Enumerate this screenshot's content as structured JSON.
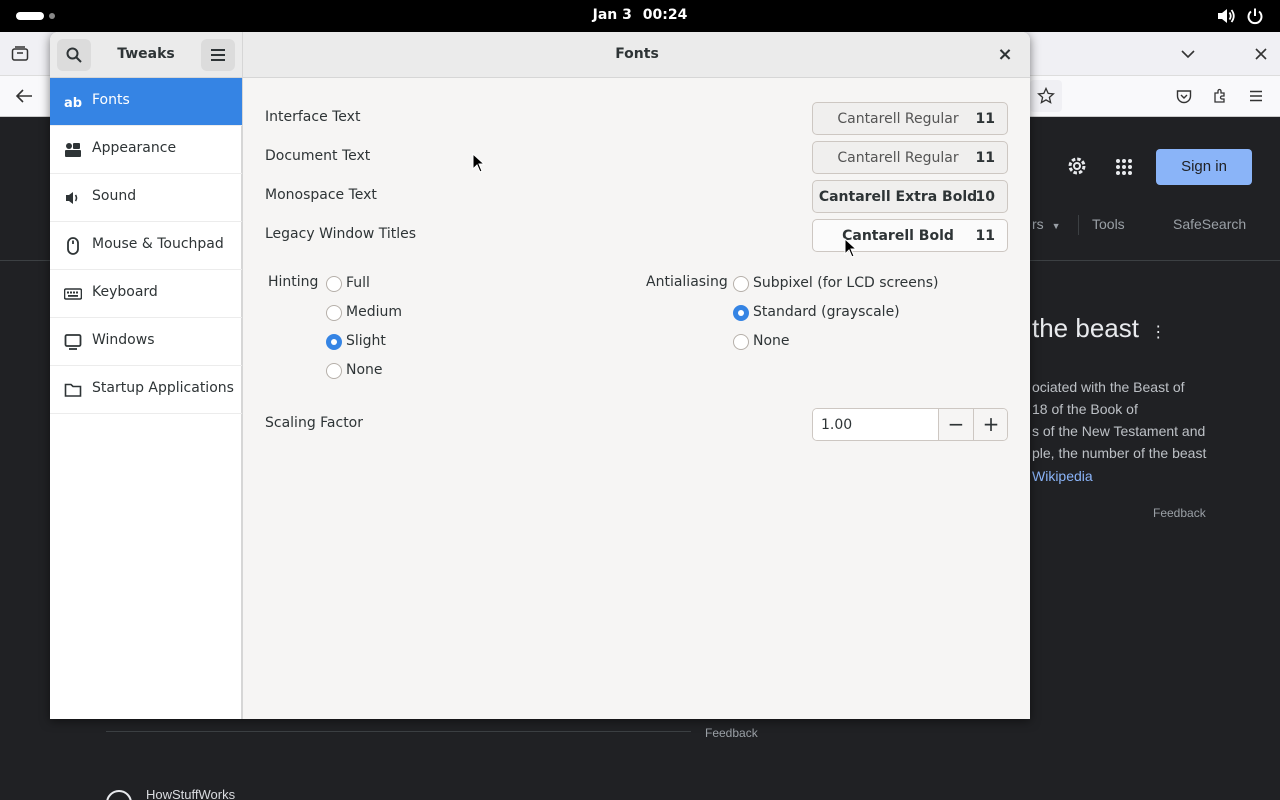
{
  "topbar": {
    "date": "Jan 3",
    "time": "00:24",
    "volume_icon": "volume-icon",
    "power_icon": "power-icon"
  },
  "browser": {
    "signin_label": "Sign in",
    "tabs_partial": [
      "rs",
      "Tools",
      "SafeSearch"
    ],
    "heading_partial": "the beast",
    "snippet_lines": [
      "ociated with the Beast of",
      "18 of the Book of",
      "s of the New Testament and",
      "ple, the number of the beast",
      "Wikipedia"
    ],
    "feedback_right": "Feedback",
    "feedback_bottom": "Feedback",
    "source_name": "HowStuffWorks"
  },
  "tweaks": {
    "title": "Tweaks",
    "page_title": "Fonts",
    "close_label": "×",
    "sidebar": [
      {
        "label": "Fonts",
        "icon": "text-icon",
        "active": true
      },
      {
        "label": "Appearance",
        "icon": "appearance-icon",
        "active": false
      },
      {
        "label": "Sound",
        "icon": "speaker-icon",
        "active": false
      },
      {
        "label": "Mouse & Touchpad",
        "icon": "mouse-icon",
        "active": false
      },
      {
        "label": "Keyboard",
        "icon": "keyboard-icon",
        "active": false
      },
      {
        "label": "Windows",
        "icon": "window-icon",
        "active": false
      },
      {
        "label": "Startup Applications",
        "icon": "folder-icon",
        "active": false
      }
    ],
    "font_rows": [
      {
        "label": "Interface Text",
        "font": "Cantarell Regular",
        "size": "11"
      },
      {
        "label": "Document Text",
        "font": "Cantarell Regular",
        "size": "11"
      },
      {
        "label": "Monospace Text",
        "font": "Cantarell Extra Bold",
        "size": "10"
      },
      {
        "label": "Legacy Window Titles",
        "font": "Cantarell Bold",
        "size": "11"
      }
    ],
    "hinting": {
      "label": "Hinting",
      "options": [
        "Full",
        "Medium",
        "Slight",
        "None"
      ],
      "selected": "Slight"
    },
    "antialiasing": {
      "label": "Antialiasing",
      "options": [
        "Subpixel (for LCD screens)",
        "Standard (grayscale)",
        "None"
      ],
      "selected": "Standard (grayscale)"
    },
    "scaling": {
      "label": "Scaling Factor",
      "value": "1.00",
      "minus": "−",
      "plus": "+"
    }
  }
}
